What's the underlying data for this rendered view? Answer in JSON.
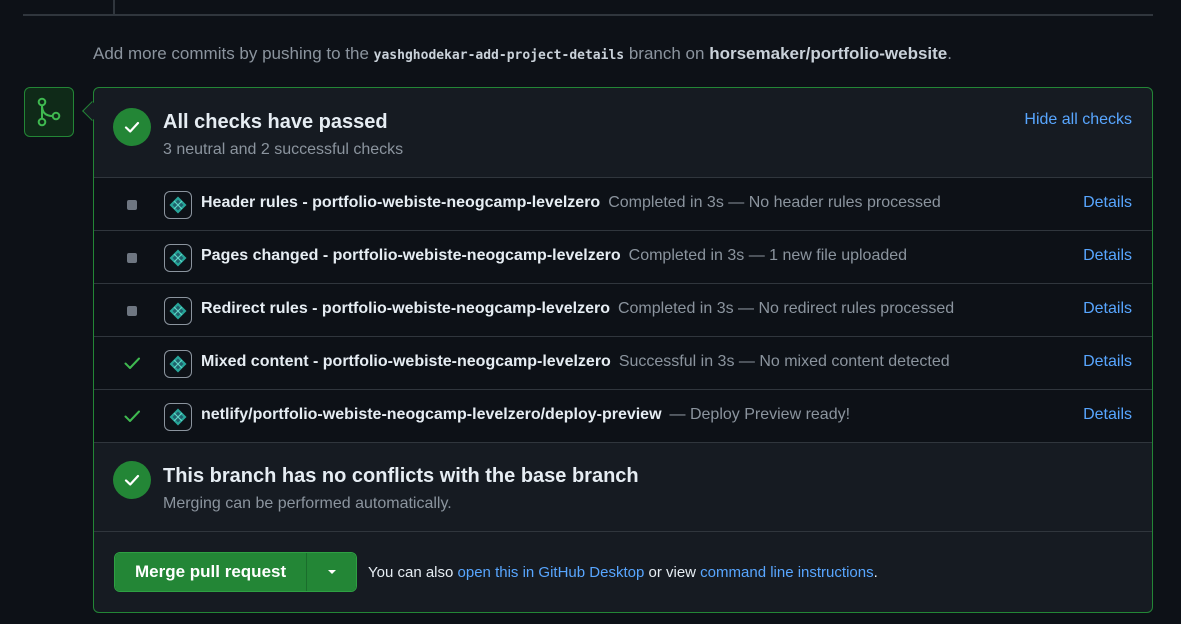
{
  "push_hint": {
    "prefix": "Add more commits by pushing to the",
    "branch": "yashghodekar-add-project-details",
    "middle": "branch on",
    "repo": "horsemaker/portfolio-website",
    "suffix": "."
  },
  "checks_section": {
    "title": "All checks have passed",
    "subtitle": "3 neutral and 2 successful checks",
    "hide_link": "Hide all checks"
  },
  "checks": [
    {
      "status": "neutral",
      "name": "Header rules - portfolio-webiste-neogcamp-levelzero",
      "desc": "Completed in 3s — No header rules processed",
      "details": "Details"
    },
    {
      "status": "neutral",
      "name": "Pages changed - portfolio-webiste-neogcamp-levelzero",
      "desc": "Completed in 3s — 1 new file uploaded",
      "details": "Details"
    },
    {
      "status": "neutral",
      "name": "Redirect rules - portfolio-webiste-neogcamp-levelzero",
      "desc": "Completed in 3s — No redirect rules processed",
      "details": "Details"
    },
    {
      "status": "success",
      "name": "Mixed content - portfolio-webiste-neogcamp-levelzero",
      "desc": "Successful in 3s — No mixed content detected",
      "details": "Details"
    },
    {
      "status": "success",
      "name": "netlify/portfolio-webiste-neogcamp-levelzero/deploy-preview",
      "desc": "— Deploy Preview ready!",
      "details": "Details"
    }
  ],
  "conflicts": {
    "title": "This branch has no conflicts with the base branch",
    "subtitle": "Merging can be performed automatically."
  },
  "merge": {
    "button_label": "Merge pull request",
    "also_prefix": "You can also",
    "desktop_link": "open this in GitHub Desktop",
    "or_view": "or view",
    "cli_link": "command line instructions",
    "suffix": "."
  },
  "colors": {
    "background": "#0d1117",
    "success_green": "#238636",
    "link_blue": "#58a6ff",
    "muted_text": "#8b949e"
  }
}
